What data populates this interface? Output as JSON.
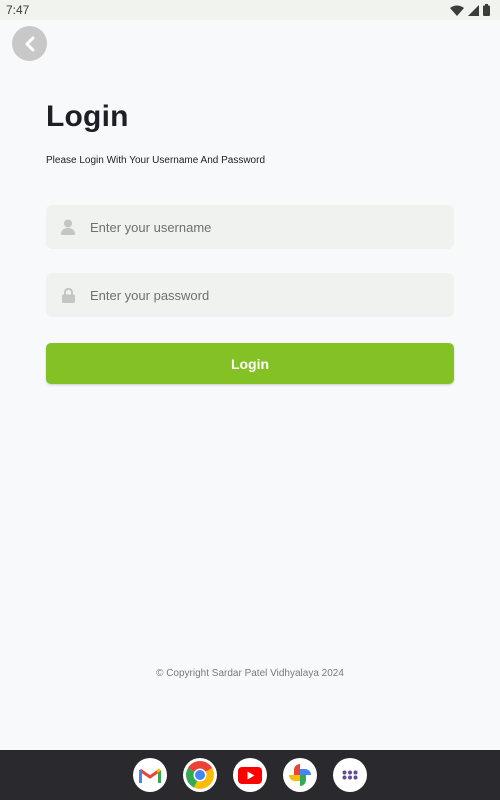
{
  "status_bar": {
    "time": "7:47",
    "icons": [
      "wifi-icon",
      "signal-icon",
      "battery-icon"
    ]
  },
  "back_button": {
    "icon": "chevron-left-icon"
  },
  "header": {
    "title": "Login",
    "subtitle": "Please Login With Your Username And Password"
  },
  "form": {
    "username": {
      "placeholder": "Enter your username",
      "value": "",
      "icon": "user-icon"
    },
    "password": {
      "placeholder": "Enter your password",
      "value": "",
      "icon": "lock-icon"
    },
    "submit_label": "Login"
  },
  "footer": {
    "copyright": "© Copyright Sardar Patel Vidhyalaya 2024"
  },
  "dock": {
    "apps": [
      "gmail-icon",
      "chrome-icon",
      "youtube-icon",
      "photos-icon",
      "app-drawer-icon"
    ]
  },
  "colors": {
    "accent": "#84c125",
    "background": "#f7f9fb",
    "field_background": "#f0f2f0",
    "dock_background": "#2a2a2e"
  }
}
